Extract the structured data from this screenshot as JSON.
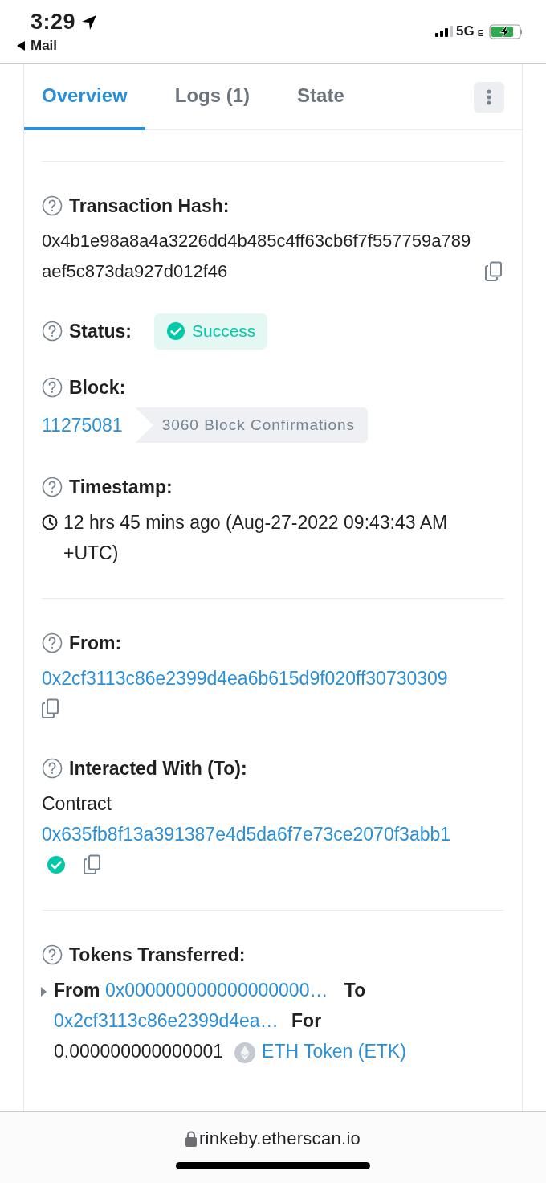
{
  "status_bar": {
    "time": "3:29",
    "back_label": "Mail",
    "network": "5G",
    "network_suffix": "E"
  },
  "tabs": [
    {
      "label": "Overview",
      "selected": true
    },
    {
      "label": "Logs (1)",
      "selected": false
    },
    {
      "label": "State",
      "selected": false
    }
  ],
  "sections": [
    {
      "fields": [
        {
          "kind": "hash",
          "label": "Transaction Hash:",
          "value": "0x4b1e98a8a4a3226dd4b485c4ff63cb6f7f557759a789aef5c873da927d012f46"
        },
        {
          "kind": "status",
          "label": "Status:",
          "badge": "Success"
        },
        {
          "kind": "block",
          "label": "Block:",
          "value": "11275081",
          "confirmations": "3060 Block Confirmations"
        },
        {
          "kind": "timestamp",
          "label": "Timestamp:",
          "value": "12 hrs 45 mins ago (Aug-27-2022 09:43:43 AM +UTC)"
        }
      ]
    },
    {
      "fields": [
        {
          "kind": "address",
          "label": "From:",
          "value": "0x2cf3113c86e2399d4ea6b615d9f020ff30730309"
        },
        {
          "kind": "contract",
          "label": "Interacted With (To):",
          "prefix": "Contract",
          "value": "0x635fb8f13a391387e4d5da6f7e73ce2070f3abb1",
          "verified": true
        }
      ]
    },
    {
      "fields": [
        {
          "kind": "tokens",
          "label": "Tokens Transferred:",
          "from_label": "From",
          "from": "0x000000000000000000…",
          "to_label": "To",
          "to": "0x2cf3113c86e2399d4ea…",
          "for_label": "For",
          "amount": "0.000000000000001",
          "token": "ETH Token (ETK)"
        }
      ]
    }
  ],
  "address_bar": {
    "url": "rinkeby.etherscan.io"
  }
}
